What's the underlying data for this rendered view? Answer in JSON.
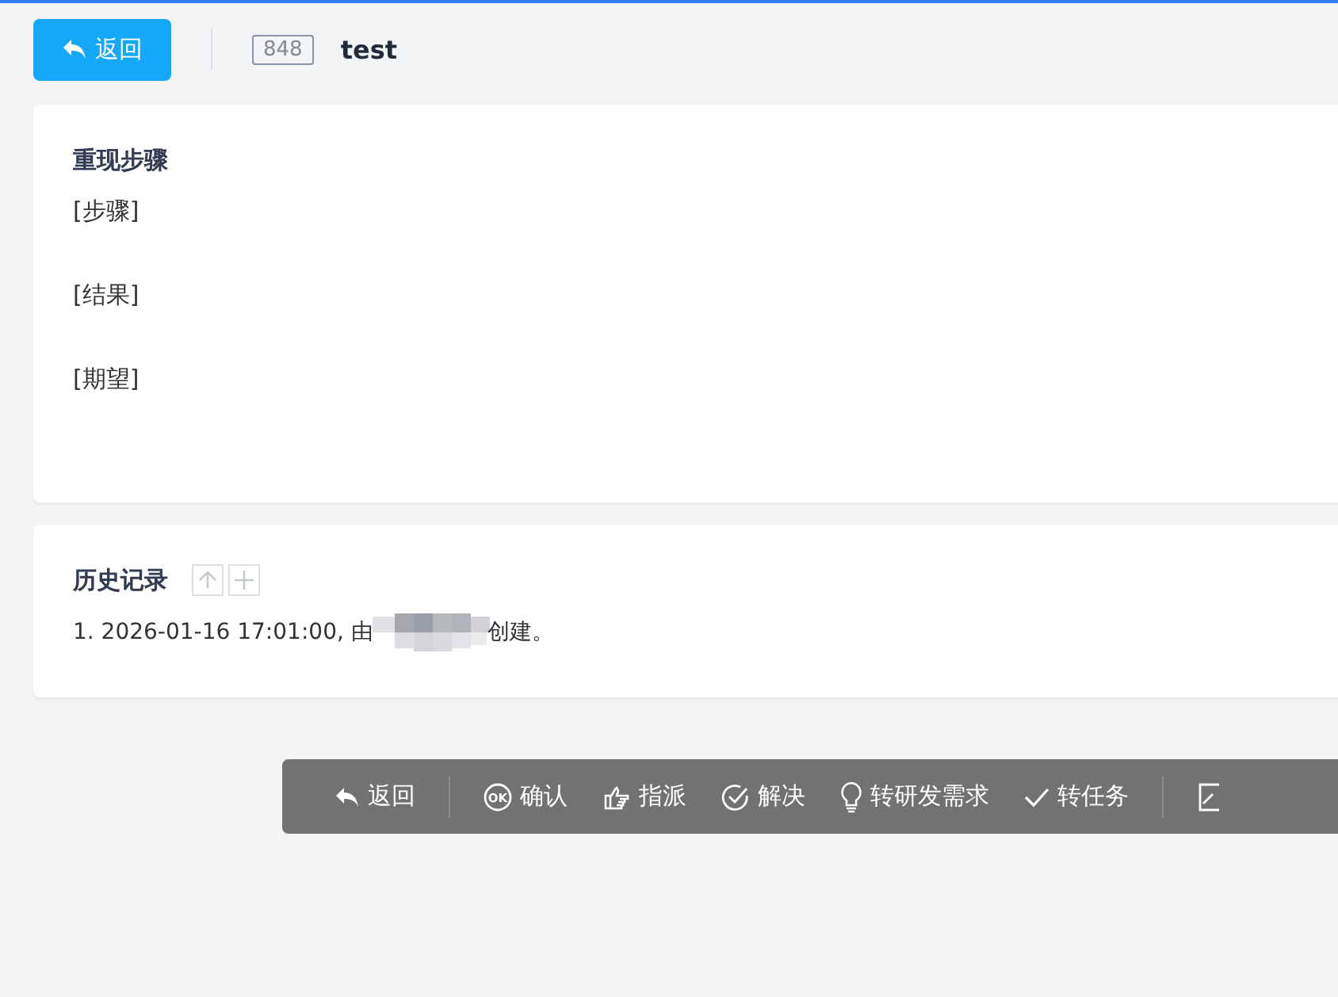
{
  "header": {
    "back_button": "返回",
    "id_badge": "848",
    "title": "test"
  },
  "steps_card": {
    "title": "重现步骤",
    "lines": [
      "[步骤]",
      "[结果]",
      "[期望]"
    ]
  },
  "history_card": {
    "title": "历史记录",
    "entries": [
      {
        "before": "1. 2026-01-16 17:01:00, 由",
        "after": "创建。"
      }
    ]
  },
  "actions": [
    {
      "kind": "back",
      "label": "返回"
    },
    {
      "kind": "ok",
      "icon_text": "OK",
      "label": "确认"
    },
    {
      "kind": "assign",
      "label": "指派"
    },
    {
      "kind": "resolve",
      "label": "解决"
    },
    {
      "kind": "idea",
      "label": "转研发需求"
    },
    {
      "kind": "task",
      "label": "转任务"
    }
  ]
}
